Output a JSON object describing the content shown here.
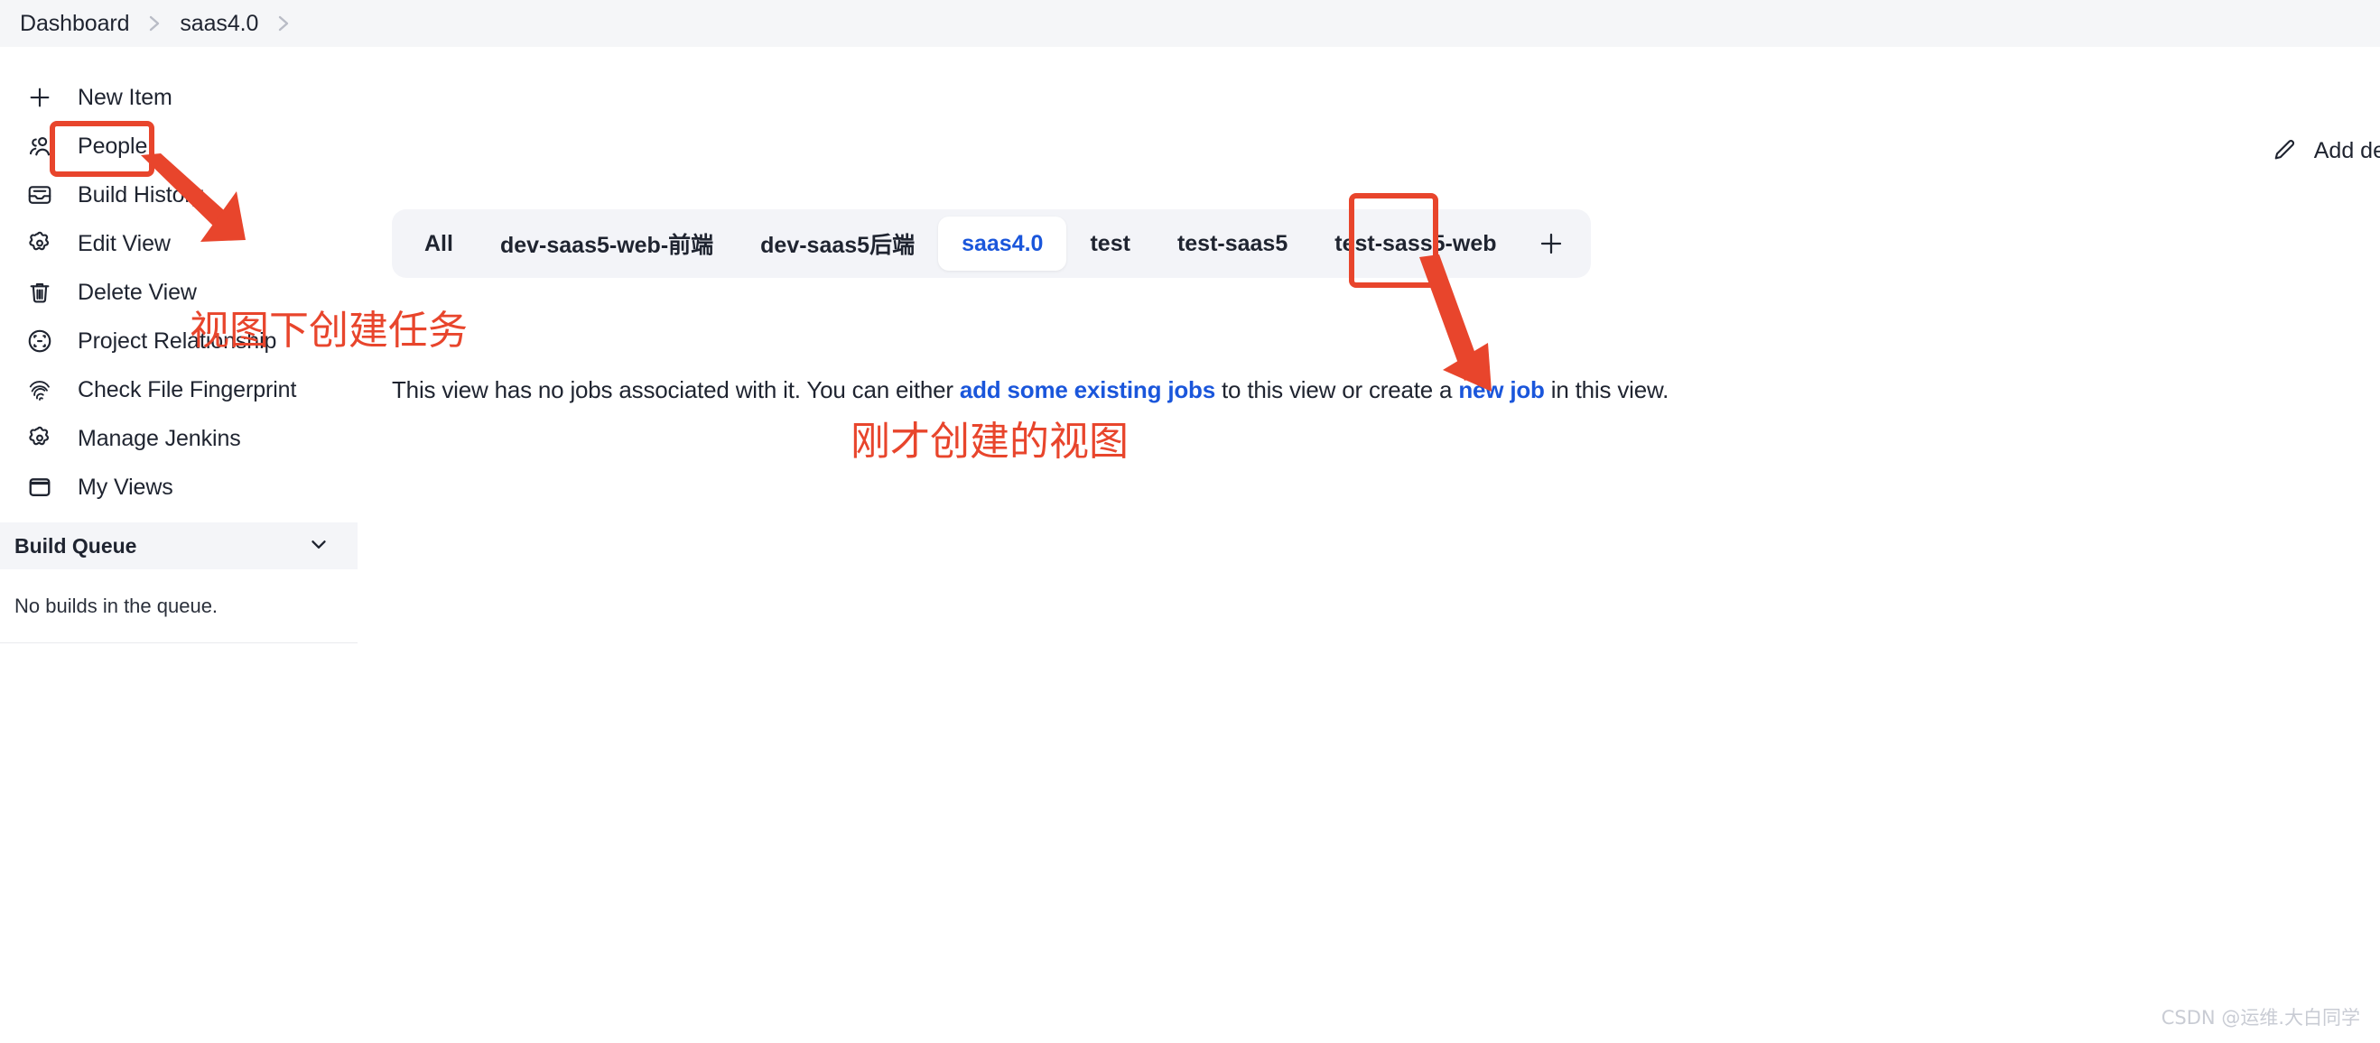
{
  "breadcrumb": {
    "items": [
      {
        "label": "Dashboard"
      },
      {
        "label": "saas4.0"
      }
    ]
  },
  "sidebar": {
    "items": [
      {
        "label": "New Item",
        "icon": "plus-icon"
      },
      {
        "label": "People",
        "icon": "people-icon"
      },
      {
        "label": "Build History",
        "icon": "inbox-icon"
      },
      {
        "label": "Edit View",
        "icon": "gear-icon"
      },
      {
        "label": "Delete View",
        "icon": "trash-icon"
      },
      {
        "label": "Project Relationship",
        "icon": "scan-circle-icon"
      },
      {
        "label": "Check File Fingerprint",
        "icon": "fingerprint-icon"
      },
      {
        "label": "Manage Jenkins",
        "icon": "gear-icon"
      },
      {
        "label": "My Views",
        "icon": "window-icon"
      }
    ],
    "build_queue": {
      "title": "Build Queue",
      "empty_text": "No builds in the queue.",
      "collapse_icon": "chevron-down-icon"
    }
  },
  "header": {
    "add_description_label": "Add de",
    "add_description_icon": "pencil-icon"
  },
  "tabs": {
    "items": [
      {
        "label": "All",
        "active": false
      },
      {
        "label": "dev-saas5-web-前端",
        "active": false
      },
      {
        "label": "dev-saas5后端",
        "active": false
      },
      {
        "label": "saas4.0",
        "active": true
      },
      {
        "label": "test",
        "active": false
      },
      {
        "label": "test-saas5",
        "active": false
      },
      {
        "label": "test-sass5-web",
        "active": false
      }
    ],
    "add_tab_icon": "plus-icon"
  },
  "main": {
    "empty_view": {
      "text_1": "This view has no jobs associated with it. You can either ",
      "link_1": "add some existing jobs",
      "text_2": " to this view or create a ",
      "link_2": "new job",
      "text_3": " in this view."
    }
  },
  "annotations": {
    "color": "#e8452c",
    "note_1": "视图下创建任务",
    "note_2": "刚才创建的视图"
  },
  "watermark": {
    "text": "CSDN @运维.大白同学"
  },
  "colors": {
    "accent_link": "#1a56db",
    "annotation_red": "#e8452c",
    "breadcrumb_bg": "#f5f6f8",
    "tabstrip_bg": "#f3f4f8",
    "text": "#1f2430"
  }
}
